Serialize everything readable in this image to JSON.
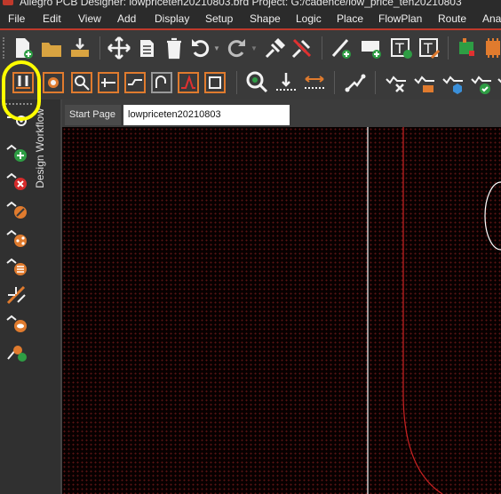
{
  "window": {
    "title": "Allegro PCB Designer: lowpriceten20210803.brd  Project: G:/cadence/low_price_ten20210803"
  },
  "menu": [
    {
      "label": "File"
    },
    {
      "label": "Edit"
    },
    {
      "label": "View"
    },
    {
      "label": "Add"
    },
    {
      "label": "Display"
    },
    {
      "label": "Setup"
    },
    {
      "label": "Shape"
    },
    {
      "label": "Logic"
    },
    {
      "label": "Place"
    },
    {
      "label": "FlowPlan"
    },
    {
      "label": "Route"
    },
    {
      "label": "Ana"
    }
  ],
  "sidebar": {
    "workflow_label": "Design Workflow"
  },
  "tabs": [
    {
      "label": "Start Page",
      "active": false
    },
    {
      "label": "lowpriceten20210803",
      "active": true
    }
  ],
  "colors": {
    "accent": "#c0392b",
    "canvas_bg": "#080000",
    "grid": "#5a1414",
    "trace": "#cc2222",
    "outline": "#ffffff",
    "annotation": "#ffff00"
  }
}
